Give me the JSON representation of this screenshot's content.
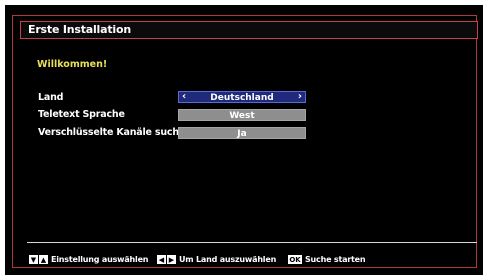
{
  "header": {
    "title": "Erste Installation"
  },
  "welcome": "Willkommen!",
  "settings": [
    {
      "label": "Land",
      "value": "Deutschland",
      "selected": true
    },
    {
      "label": "Teletext Sprache",
      "value": "West",
      "selected": false
    },
    {
      "label": "Verschlüsselte Kanäle suchen",
      "value": "Ja",
      "selected": false
    }
  ],
  "arrows": {
    "left": "‹",
    "right": "›"
  },
  "footer": {
    "hint1": {
      "keys": [
        "▼",
        "▲"
      ],
      "text": "Einstellung auswählen"
    },
    "hint2": {
      "keys": [
        "◀",
        "▶"
      ],
      "text": "Um Land auszuwählen"
    },
    "hint3": {
      "key": "OK",
      "text": "Suche starten"
    }
  },
  "colors": {
    "background": "#000000",
    "frame_border": "#b03a3a",
    "selected_box": "#1f2a7d",
    "normal_box": "#8e8e8e",
    "welcome_text": "#e8e05a"
  }
}
